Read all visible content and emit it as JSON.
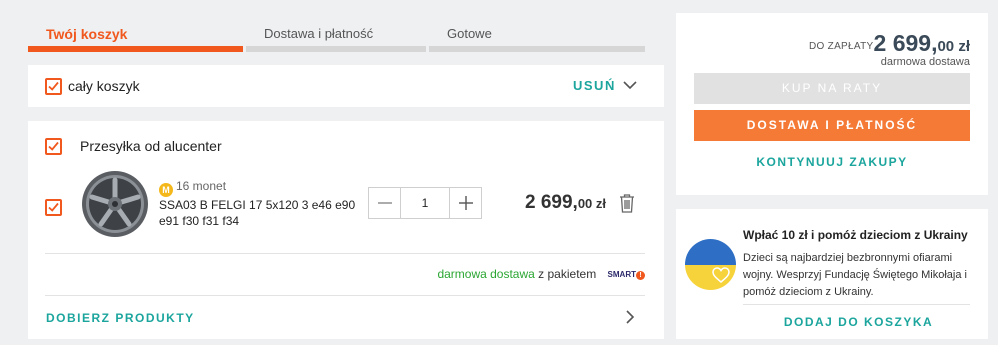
{
  "stepper": {
    "steps": [
      {
        "label": "Twój koszyk"
      },
      {
        "label": "Dostawa i płatność"
      },
      {
        "label": "Gotowe"
      }
    ]
  },
  "cart": {
    "select_all_label": "cały koszyk",
    "remove_label": "USUŃ"
  },
  "group": {
    "seller_label": "Przesyłka od alucenter",
    "item": {
      "coins_label": "16 monet",
      "coin_icon": "M",
      "name": "SSA03 B FELGI 17 5x120 3 e46 e90 e91 f30 f31 f34",
      "quantity": "1",
      "price_int": "2 699,",
      "price_dec": "00 zł"
    },
    "shipping": {
      "free_label": "darmowa dostawa",
      "package_label": "z pakietem",
      "smart_logo": "SMART"
    },
    "pick_products_label": "DOBIERZ PRODUKTY"
  },
  "summary": {
    "to_pay_label": "DO ZAPŁATY",
    "total_int": "2 699,",
    "total_dec": "00 zł",
    "free_delivery": "darmowa dostawa",
    "installments_button": "KUP NA RATY",
    "checkout_button": "DOSTAWA I PŁATNOŚĆ",
    "continue_label": "KONTYNUUJ ZAKUPY"
  },
  "charity": {
    "title": "Wpłać 10 zł i pomóż dzieciom z Ukrainy",
    "body": "Dzieci są najbardziej bezbronnymi ofiarami wojny. Wesprzyj Fundację Świętego Mikołaja i pomóż dzieciom z Ukrainy.",
    "add_label": "DODAJ DO KOSZYKA"
  },
  "colors": {
    "accent": "#f1581d",
    "teal": "#1ba59d",
    "green": "#2ba632",
    "flag_blue": "#2e6fc5",
    "flag_yellow": "#f6d23b"
  }
}
